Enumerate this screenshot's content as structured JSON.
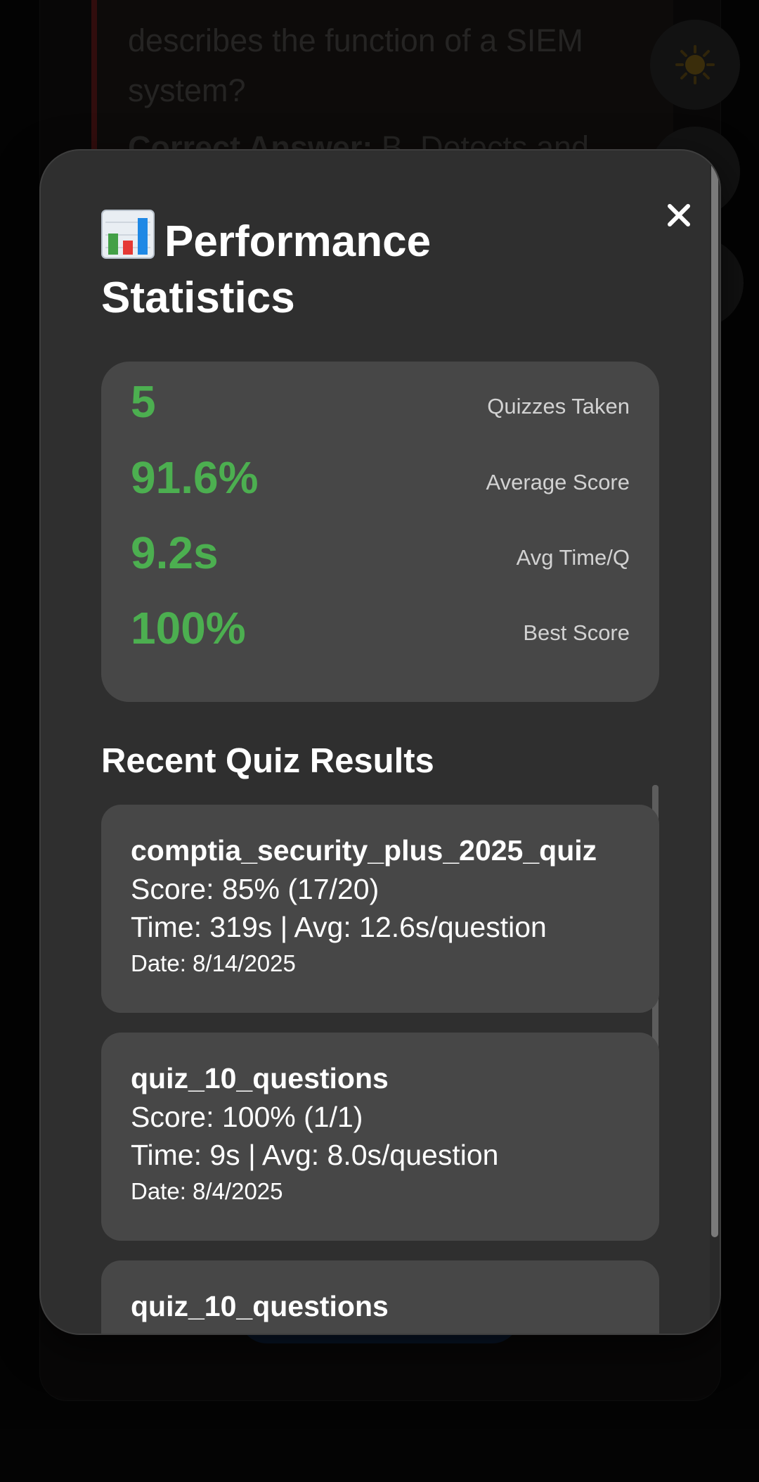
{
  "background": {
    "question_text": "describes the function of a SIEM system?",
    "correct_label": "Correct Answer:",
    "correct_rest": " B. Detects and"
  },
  "modal": {
    "title": "Performance Statistics",
    "title_icon": "bar-chart-icon",
    "close_symbol": "×"
  },
  "stats": [
    {
      "value": "5",
      "label": "Quizzes Taken"
    },
    {
      "value": "91.6%",
      "label": "Average Score"
    },
    {
      "value": "9.2s",
      "label": "Avg Time/Q"
    },
    {
      "value": "100%",
      "label": "Best Score"
    }
  ],
  "recent": {
    "title": "Recent Quiz Results",
    "items": [
      {
        "name": "comptia_security_plus_2025_quiz",
        "score": "Score: 85% (17/20)",
        "time": "Time: 319s | Avg: 12.6s/question",
        "date": "Date: 8/14/2025"
      },
      {
        "name": "quiz_10_questions",
        "score": "Score: 100% (1/1)",
        "time": "Time: 9s | Avg: 8.0s/question",
        "date": "Date: 8/4/2025"
      },
      {
        "name": "quiz_10_questions"
      }
    ]
  },
  "colors": {
    "accent_green": "#4caf50",
    "modal_bg": "#2f2f2f",
    "card_bg": "#474747"
  }
}
